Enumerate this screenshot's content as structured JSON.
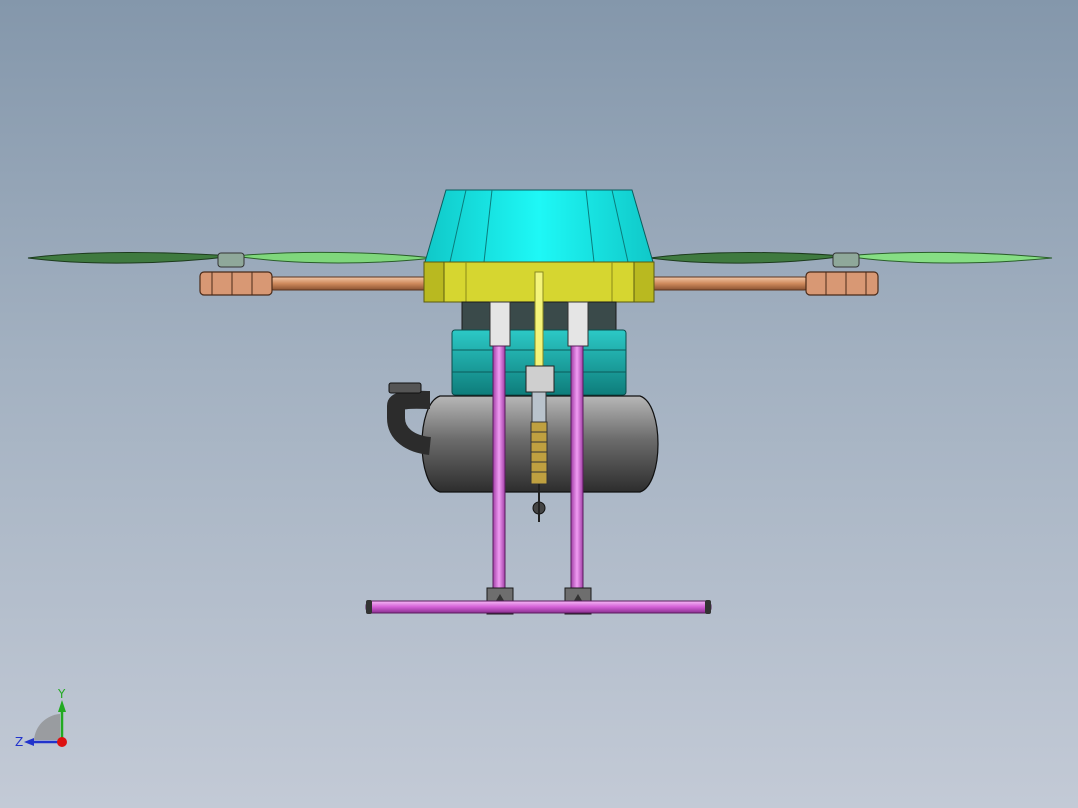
{
  "view": {
    "background_top": "#8497ab",
    "background_bottom": "#c3cad6"
  },
  "model": {
    "colors": {
      "canopy": "#19f2f0",
      "control_box": "#d6d630",
      "motor_arm": "#d7926a",
      "rotor_blade": "#4f8a4f",
      "rotor_blade_light": "#8ee38a",
      "tank": "#5a5a5a",
      "landing_gear": "#d45fd6",
      "engine_block": "#1aa6a3",
      "fuel_line": "#f0f060"
    }
  },
  "triad": {
    "y_label": "Y",
    "z_label": "Z",
    "y_color": "#22aa22",
    "z_color": "#2233cc",
    "x_color": "#dd1111"
  }
}
